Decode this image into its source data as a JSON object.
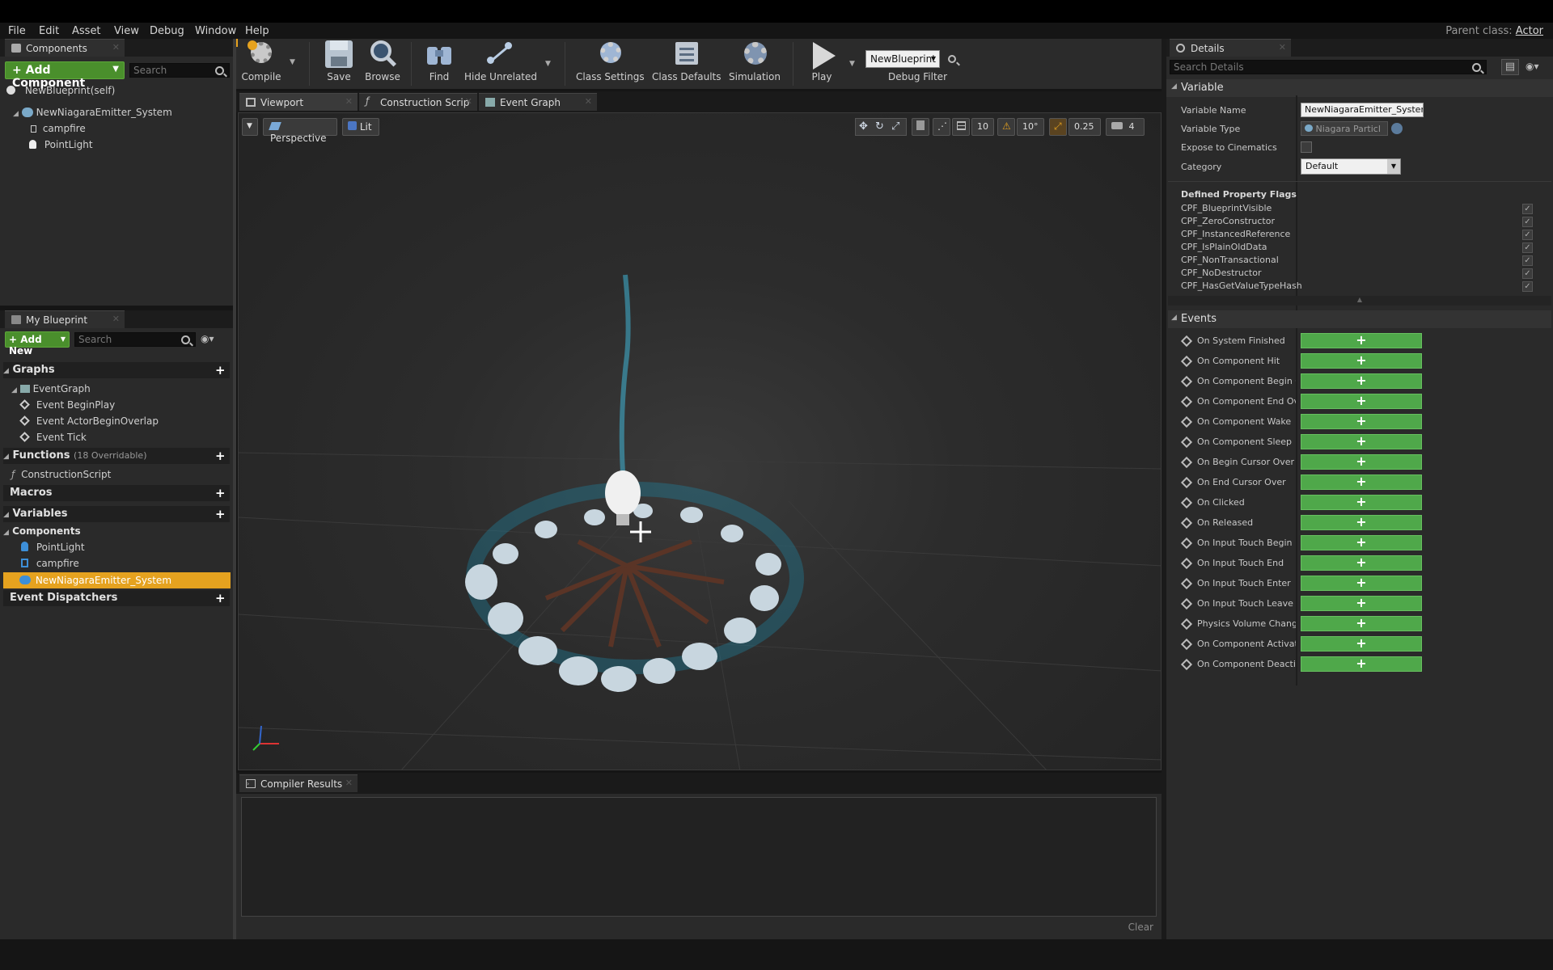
{
  "menu": [
    "File",
    "Edit",
    "Asset",
    "View",
    "Debug",
    "Window",
    "Help"
  ],
  "parent_class": {
    "label": "Parent class:",
    "value": "Actor"
  },
  "components_panel": {
    "tab": "Components",
    "add_button": "+ Add Component",
    "search_placeholder": "Search",
    "tree": [
      {
        "label": "NewBlueprint(self)"
      },
      {
        "label": "NewNiagaraEmitter_System"
      },
      {
        "label": "campfire"
      },
      {
        "label": "PointLight"
      }
    ]
  },
  "toolbar": {
    "buttons": [
      "Compile",
      "Save",
      "Browse",
      "Find",
      "Hide Unrelated",
      "Class Settings",
      "Class Defaults",
      "Simulation",
      "Play"
    ],
    "debug_select": "NewBlueprint",
    "debug_filter": "Debug Filter"
  },
  "editor_tabs": [
    "Viewport",
    "Construction Scrip",
    "Event Graph"
  ],
  "viewport": {
    "perspective": "Perspective",
    "lit": "Lit",
    "grid_snap": "10",
    "rot_snap": "10°",
    "scale_snap": "0.25",
    "cam_speed": "4"
  },
  "my_blueprint": {
    "tab": "My Blueprint",
    "add_new": "+ Add New",
    "search_placeholder": "Search",
    "sections": {
      "graphs": "Graphs",
      "functions": "Functions",
      "functions_note": "(18 Overridable)",
      "macros": "Macros",
      "variables": "Variables",
      "components": "Components",
      "dispatchers": "Event Dispatchers"
    },
    "graph_items": [
      "EventGraph",
      "Event BeginPlay",
      "Event ActorBeginOverlap",
      "Event Tick"
    ],
    "function_items": [
      "ConstructionScript"
    ],
    "component_vars": [
      "PointLight",
      "campfire",
      "NewNiagaraEmitter_System"
    ]
  },
  "compiler": {
    "tab": "Compiler Results",
    "clear": "Clear"
  },
  "details": {
    "tab": "Details",
    "search_placeholder": "Search Details",
    "variable_section": "Variable",
    "variable_name_label": "Variable Name",
    "variable_name": "NewNiagaraEmitter_System",
    "variable_type_label": "Variable Type",
    "variable_type": "Niagara Particl",
    "expose_label": "Expose to Cinematics",
    "category_label": "Category",
    "category": "Default",
    "flags_header": "Defined Property Flags",
    "flags": [
      "CPF_BlueprintVisible",
      "CPF_ZeroConstructor",
      "CPF_InstancedReference",
      "CPF_IsPlainOldData",
      "CPF_NonTransactional",
      "CPF_NoDestructor",
      "CPF_HasGetValueTypeHash"
    ],
    "events_section": "Events",
    "events": [
      "On System Finished",
      "On Component Hit",
      "On Component Begin Ov",
      "On Component End Over",
      "On Component Wake",
      "On Component Sleep",
      "On Begin Cursor Over",
      "On End Cursor Over",
      "On Clicked",
      "On Released",
      "On Input Touch Begin",
      "On Input Touch End",
      "On Input Touch Enter",
      "On Input Touch Leave",
      "Physics Volume Change",
      "On Component Activatec",
      "On Component Deactiva"
    ]
  },
  "colors": {
    "accent_green": "#4fa84a",
    "selection": "#e5a21f"
  }
}
